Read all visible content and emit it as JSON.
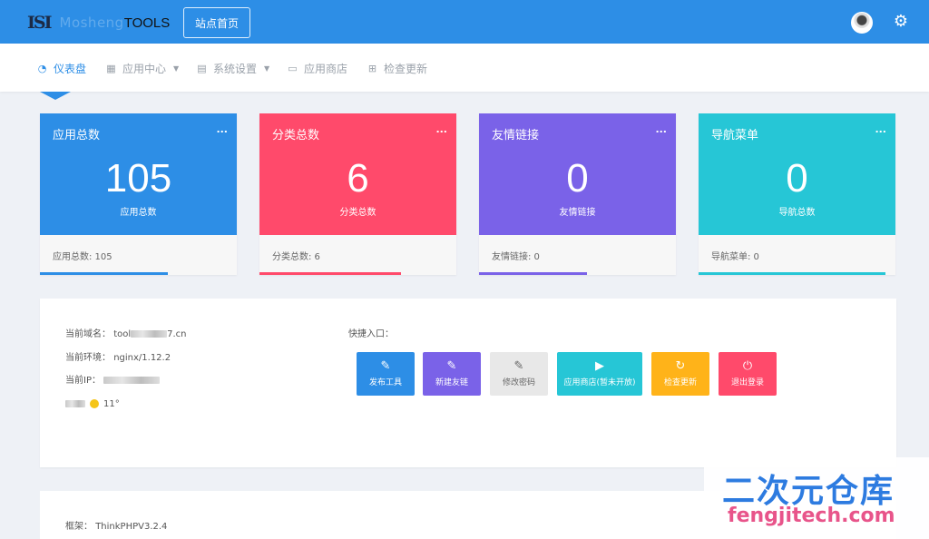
{
  "header": {
    "logo_mark": "ISI",
    "logo_faded": "Mosheng",
    "logo_tools": "TOOLS",
    "home_button": "站点首页"
  },
  "nav": {
    "items": [
      {
        "label": "仪表盘",
        "icon": "dashboard-icon",
        "active": true
      },
      {
        "label": "应用中心",
        "icon": "grid-icon",
        "dropdown": true
      },
      {
        "label": "系统设置",
        "icon": "table-icon",
        "dropdown": true
      },
      {
        "label": "应用商店",
        "icon": "laptop-icon"
      },
      {
        "label": "检查更新",
        "icon": "sitemap-icon"
      }
    ]
  },
  "cards": [
    {
      "title": "应用总数",
      "more": "...",
      "value": "105",
      "subtitle": "应用总数",
      "footer": "应用总数: 105",
      "color": "#2d8ee6",
      "bar_fill": 0.65
    },
    {
      "title": "分类总数",
      "more": "...",
      "value": "6",
      "subtitle": "分类总数",
      "footer": "分类总数: 6",
      "color": "#ff4a6b",
      "bar_fill": 0.72
    },
    {
      "title": "友情链接",
      "more": "...",
      "value": "0",
      "subtitle": "友情链接",
      "footer": "友情链接: 0",
      "color": "#7a62e8",
      "bar_fill": 0.55
    },
    {
      "title": "导航菜单",
      "more": "...",
      "value": "0",
      "subtitle": "导航总数",
      "footer": "导航菜单: 0",
      "color": "#26c6d6",
      "bar_fill": 0.95
    }
  ],
  "info": {
    "domain_label": "当前域名：",
    "domain_prefix": "tool",
    "domain_suffix": "7.cn",
    "env_label": "当前环境：",
    "env_value": "nginx/1.12.2",
    "ip_label": "当前IP：",
    "temperature": "11°"
  },
  "quick": {
    "label": "快捷入口：",
    "buttons": [
      {
        "label": "发布工具",
        "icon": "edit-icon",
        "color": "#2d8ee6"
      },
      {
        "label": "新建友链",
        "icon": "edit-icon",
        "color": "#7a62e8"
      },
      {
        "label": "修改密码",
        "icon": "edit-icon",
        "color": "#e8e8e8"
      },
      {
        "label": "应用商店(暂未开放)",
        "icon": "play-icon",
        "color": "#26c6d6"
      },
      {
        "label": "检查更新",
        "icon": "refresh-icon",
        "color": "#ffb319"
      },
      {
        "label": "退出登录",
        "icon": "power-icon",
        "color": "#ff4a6b"
      }
    ]
  },
  "framework": {
    "label": "框架：",
    "value": "ThinkPHPV3.2.4"
  },
  "watermark": {
    "cn": "二次元仓库",
    "en": "fengjitech.com"
  }
}
